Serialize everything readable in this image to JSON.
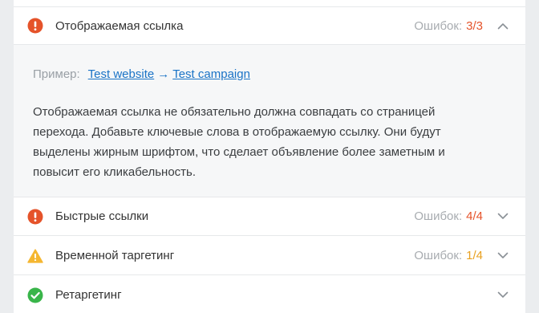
{
  "sections": [
    {
      "title": "Отображаемая ссылка",
      "errors_label": "Ошибок:",
      "errors_count": "3/3",
      "status": "error",
      "status_icon": "error-circle-icon",
      "count_color": "#e5532a",
      "expanded": true
    },
    {
      "title": "Быстрые ссылки",
      "errors_label": "Ошибок:",
      "errors_count": "4/4",
      "status": "error",
      "status_icon": "error-circle-icon",
      "count_color": "#e5532a",
      "expanded": false
    },
    {
      "title": "Временной таргетинг",
      "errors_label": "Ошибок:",
      "errors_count": "1/4",
      "status": "warning",
      "status_icon": "warning-triangle-icon",
      "count_color": "#e8a020",
      "expanded": false
    },
    {
      "title": "Ретаргетинг",
      "status": "ok",
      "status_icon": "check-circle-icon",
      "expanded": false
    }
  ],
  "details": {
    "example_label": "Пример:",
    "link_part1": "Test website",
    "arrow": "→",
    "link_part2": "Test campaign",
    "description": "Отображаемая ссылка не обязательно должна совпадать со страницей перехода. Добавьте ключевые слова в отображаемую ссылку. Они будут выделены жирным шрифтом, что сделает объявление более заметным и повысит его кликабельность."
  },
  "colors": {
    "error": "#e5532a",
    "warning": "#f5b731",
    "ok": "#39b54a",
    "link": "#1a73c6"
  }
}
